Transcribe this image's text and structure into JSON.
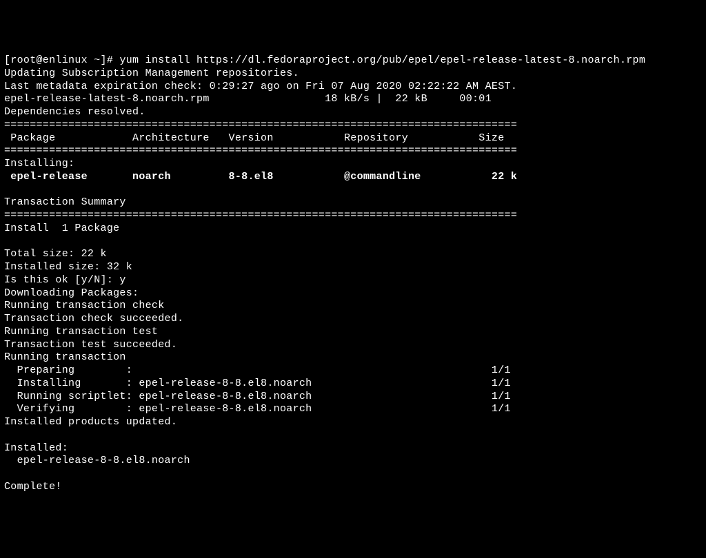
{
  "prompt": "[root@enlinux ~]# ",
  "command": "yum install https://dl.fedoraproject.org/pub/epel/epel-release-latest-8.noarch.rpm",
  "lines": {
    "updating": "Updating Subscription Management repositories.",
    "metadata": "Last metadata expiration check: 0:29:27 ago on Fri 07 Aug 2020 02:22:22 AM AEST.",
    "rpm_status": "epel-release-latest-8.noarch.rpm                  18 kB/s |  22 kB     00:01",
    "deps": "Dependencies resolved.",
    "divider": "================================================================================",
    "header": " Package            Architecture   Version           Repository           Size",
    "installing_label": "Installing:",
    "pkg_row": " epel-release       noarch         8-8.el8           @commandline           22 k",
    "summary_label": "Transaction Summary",
    "install_count": "Install  1 Package",
    "blank": "",
    "total_size": "Total size: 22 k",
    "installed_size": "Installed size: 32 k",
    "confirm": "Is this ok [y/N]: y",
    "downloading": "Downloading Packages:",
    "run_check": "Running transaction check",
    "check_ok": "Transaction check succeeded.",
    "run_test": "Running transaction test",
    "test_ok": "Transaction test succeeded.",
    "run_txn": "Running transaction",
    "preparing": "  Preparing        :                                                        1/1",
    "installing_pkg": "  Installing       : epel-release-8-8.el8.noarch                            1/1",
    "scriptlet": "  Running scriptlet: epel-release-8-8.el8.noarch                            1/1",
    "verifying": "  Verifying        : epel-release-8-8.el8.noarch                            1/1",
    "products": "Installed products updated.",
    "installed_label": "Installed:",
    "installed_pkg": "  epel-release-8-8.el8.noarch",
    "complete": "Complete!"
  }
}
